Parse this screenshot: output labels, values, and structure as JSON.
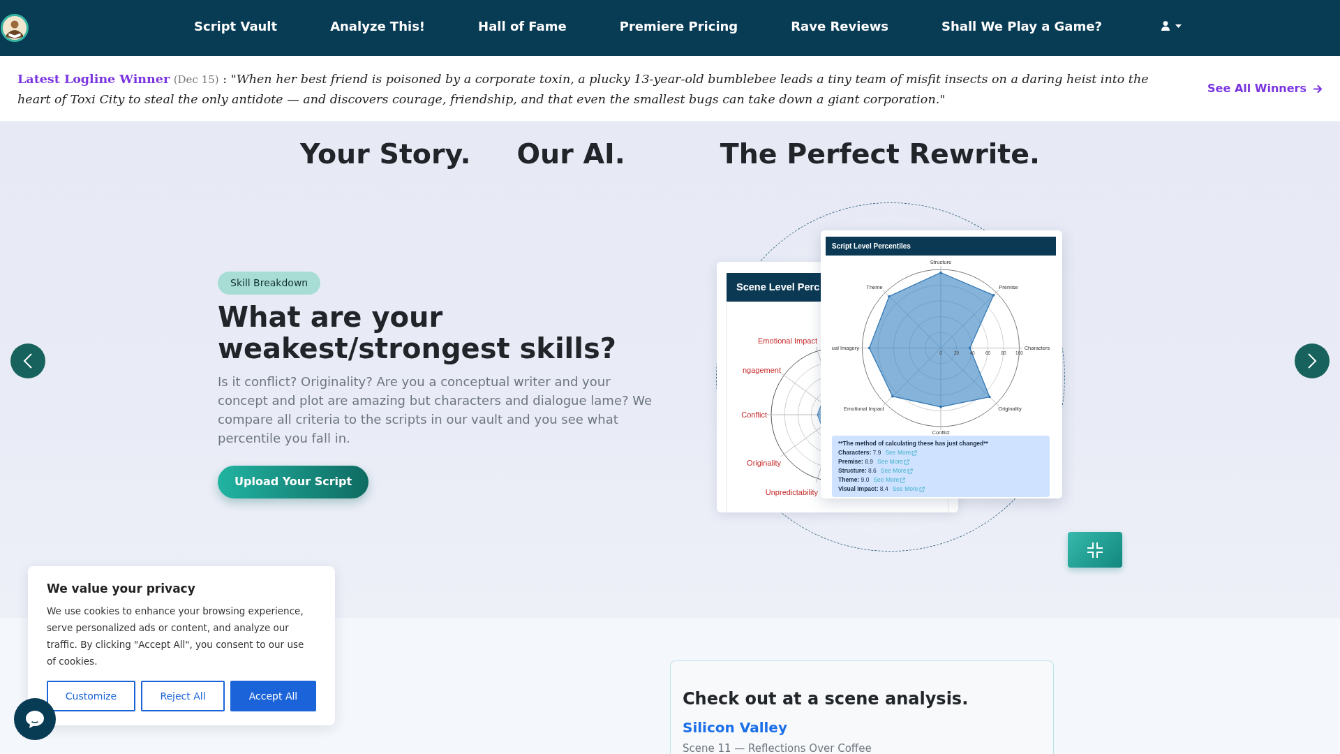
{
  "navbar": {
    "links": [
      "Script Vault",
      "Analyze This!",
      "Hall of Fame",
      "Premiere Pricing",
      "Rave Reviews",
      "Shall We Play a Game?"
    ]
  },
  "logline_banner": {
    "title": "Latest Logline Winner",
    "date": "(Dec 15)",
    "separator": ":",
    "logline": "\"When her best friend is poisoned by a corporate toxin, a plucky 13-year-old bumblebee leads a tiny team of misfit insects on a daring heist into the heart of Toxi City to steal the only antidote — and discovers courage, friendship, and that even the smallest bugs can take down a giant corporation.\"",
    "link": "See All Winners"
  },
  "hero": {
    "taglines": [
      "Your Story.",
      "Our AI.",
      "The Perfect Rewrite."
    ],
    "slide": {
      "badge": "Skill Breakdown",
      "heading": "What are your weakest/strongest skills?",
      "text": "Is it conflict? Originality? Are you a conceptual writer and your concept and plot are amazing but characters and dialogue lame? We compare all criteria to the scripts in our vault and you see what percentile you fall in.",
      "button": "Upload Your Script"
    },
    "scene_card": {
      "title": "Scene Level Perc",
      "axes": [
        "Emotional Impact",
        "ngagement",
        "Conflict",
        "Originality",
        "Unpredictability"
      ]
    },
    "script_card": {
      "title": "Script Level Percentiles",
      "axes": [
        "Structure",
        "Theme",
        "Premise",
        "ual Imagery",
        "Characters",
        "Emotional Impact",
        "Originality",
        "Conflict"
      ],
      "ticks": [
        "0",
        "20",
        "40",
        "60",
        "80",
        "100"
      ],
      "note": {
        "heading": "**The method of calculating these has just changed**",
        "scores": [
          {
            "text": "**Characters:** 7.9",
            "link": "See More"
          },
          {
            "text": "**Premise:** 8.9",
            "link": "See More"
          },
          {
            "text": "**Structure:** 8.6",
            "link": "See More"
          },
          {
            "text": "**Theme:** 9.0",
            "link": "See More"
          },
          {
            "text": "**Visual Impact:** 8.4",
            "link": "See More"
          }
        ]
      }
    }
  },
  "cookie_banner": {
    "title": "We value your privacy",
    "text": "We use cookies to enhance your browsing experience, serve personalized ads or content, and analyze our traffic. By clicking \"Accept All\", you consent to our use of cookies.",
    "buttons": [
      {
        "label": "Customize",
        "kind": "outline"
      },
      {
        "label": "Reject All",
        "kind": "outline"
      },
      {
        "label": "Accept All",
        "kind": "primary"
      }
    ]
  },
  "scene_analysis": {
    "heading": "Check out at a scene analysis.",
    "title": "Silicon Valley",
    "subtitle": "Scene 11 — Reflections Over Coffee"
  }
}
